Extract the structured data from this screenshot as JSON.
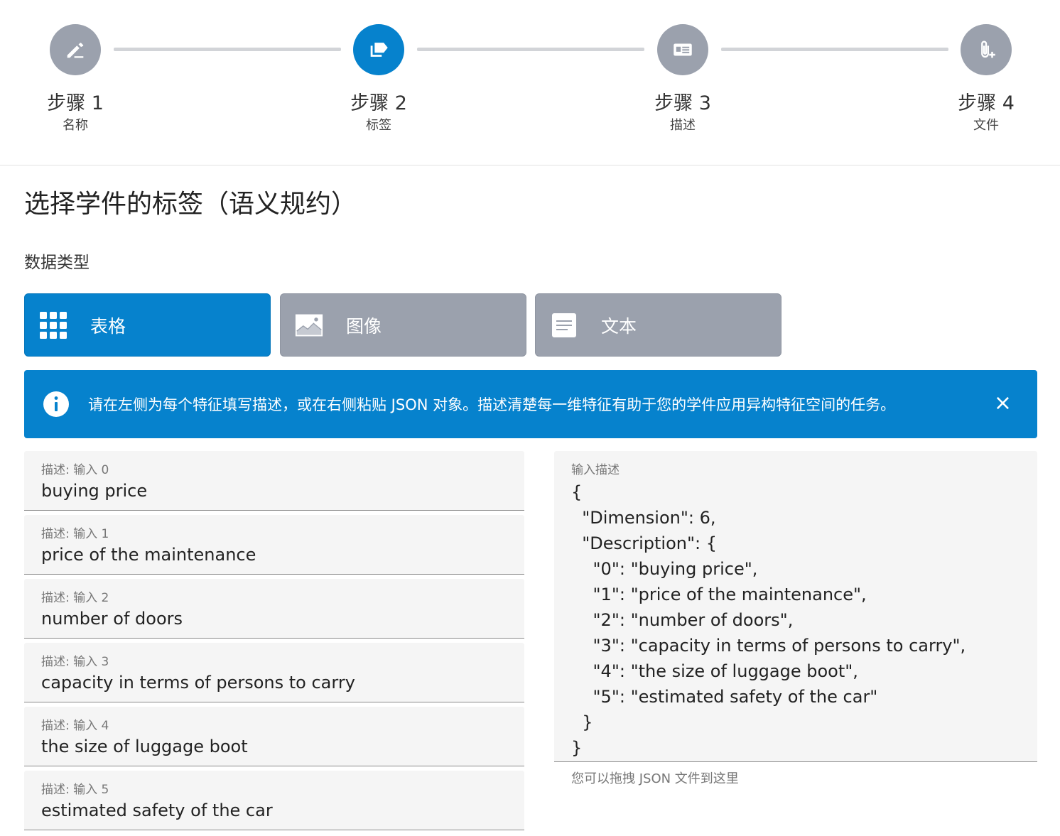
{
  "stepper": {
    "steps": [
      {
        "title": "步骤 1",
        "subtitle": "名称",
        "icon": "pencil-icon"
      },
      {
        "title": "步骤 2",
        "subtitle": "标签",
        "icon": "tag-icon"
      },
      {
        "title": "步骤 3",
        "subtitle": "描述",
        "icon": "card-text-icon"
      },
      {
        "title": "步骤 4",
        "subtitle": "文件",
        "icon": "paperclip-plus-icon"
      }
    ],
    "active_index": 1,
    "colors": {
      "active": "#0682cd",
      "inactive": "#9ba1ad"
    }
  },
  "page": {
    "title": "选择学件的标签（语义规约）",
    "section_label": "数据类型"
  },
  "data_types": [
    {
      "label": "表格",
      "icon": "grid-icon",
      "selected": true
    },
    {
      "label": "图像",
      "icon": "image-icon",
      "selected": false
    },
    {
      "label": "文本",
      "icon": "text-doc-icon",
      "selected": false
    }
  ],
  "banner": {
    "text": "请在左侧为每个特征填写描述，或在右侧粘贴 JSON 对象。描述清楚每一维特征有助于您的学件应用异构特征空间的任务。",
    "close": "×",
    "icon": "info-icon"
  },
  "fields": [
    {
      "label": "描述: 输入 0",
      "value": "buying price"
    },
    {
      "label": "描述: 输入 1",
      "value": "price of the maintenance"
    },
    {
      "label": "描述: 输入 2",
      "value": "number of doors"
    },
    {
      "label": "描述: 输入 3",
      "value": "capacity in terms of persons to carry"
    },
    {
      "label": "描述: 输入 4",
      "value": "the size of luggage boot"
    },
    {
      "label": "描述: 输入 5",
      "value": "estimated safety of the car"
    }
  ],
  "json_input": {
    "label": "输入描述",
    "value": "{\n  \"Dimension\": 6,\n  \"Description\": {\n    \"0\": \"buying price\",\n    \"1\": \"price of the maintenance\",\n    \"2\": \"number of doors\",\n    \"3\": \"capacity in terms of persons to carry\",\n    \"4\": \"the size of luggage boot\",\n    \"5\": \"estimated safety of the car\"\n  }\n}",
    "hint": "您可以拖拽 JSON 文件到这里"
  }
}
